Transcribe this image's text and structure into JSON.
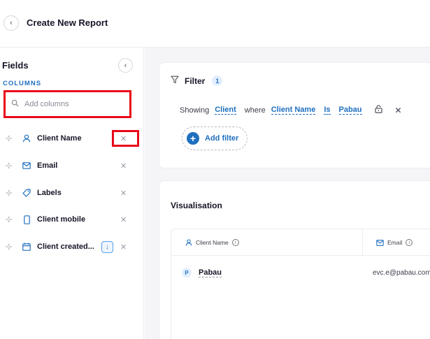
{
  "header": {
    "title": "Create New Report"
  },
  "sidebar": {
    "title": "Fields",
    "section_label": "COLUMNS",
    "search": {
      "placeholder": "Add columns",
      "value": ""
    },
    "fields": [
      {
        "label": "Client Name",
        "icon": "user-icon"
      },
      {
        "label": "Email",
        "icon": "mail-icon"
      },
      {
        "label": "Labels",
        "icon": "tag-icon"
      },
      {
        "label": "Client mobile",
        "icon": "mobile-icon"
      },
      {
        "label": "Client created...",
        "icon": "calendar-icon"
      }
    ],
    "remove_glyph": "✕"
  },
  "filter": {
    "title": "Filter",
    "count": "1",
    "sentence": {
      "showing": "Showing",
      "entity": "Client",
      "where": "where",
      "field": "Client Name",
      "operator": "Is",
      "value": "Pabau"
    },
    "add_label": "Add filter"
  },
  "visualisation": {
    "title": "Visualisation",
    "columns": [
      {
        "label": "Client Name",
        "icon": "user-icon"
      },
      {
        "label": "Email",
        "icon": "mail-icon"
      }
    ],
    "rows": [
      {
        "avatar": "P",
        "name": "Pabau",
        "email": "evc.e@pabau.com"
      }
    ]
  },
  "colors": {
    "accent": "#1f6fbf",
    "highlight": "#e8081a"
  }
}
